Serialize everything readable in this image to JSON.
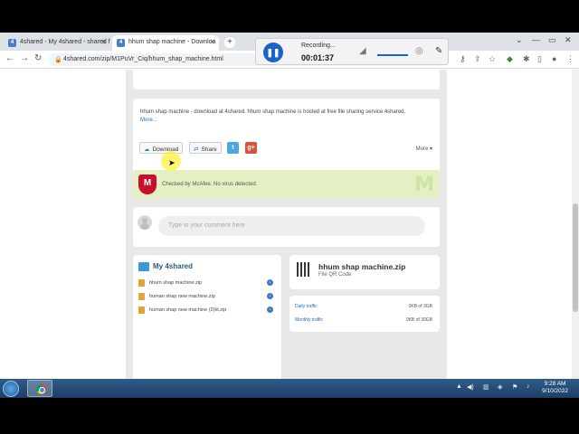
{
  "browser": {
    "tabs": [
      {
        "label": "4shared - My 4shared - shared f",
        "active": false
      },
      {
        "label": "hhum shap machine - Downloa",
        "active": true
      }
    ],
    "url": "4shared.com/zip/M1PuVr_Ciq/hhum_shap_machine.html"
  },
  "recorder": {
    "status": "Recording...",
    "timer": "00:01:37"
  },
  "file": {
    "description": "hhum shap machine - download at 4shared. hhum shap machine is hosted at free file sharing service 4shared.",
    "more_link": "More...",
    "buttons": {
      "download": "Download",
      "share": "Share",
      "twitter": "t",
      "gplus": "g+"
    },
    "more_dropdown": "More ▾",
    "scan_text": "Checked by McAfee. No virus detected.",
    "name": "hhum shap machine.zip",
    "qr_label": "File QR Code"
  },
  "comment": {
    "placeholder": "Type in your comment here"
  },
  "my4shared": {
    "title": "My 4shared",
    "files": [
      "hhum shap machine.zip",
      "human shap new machine.zip",
      "human shap new machine (2)kt.zip"
    ]
  },
  "traffic": [
    {
      "label": "Daily traffic",
      "value": "0KB of 3GB"
    },
    {
      "label": "Monthly traffic",
      "value": "0KB of 30GB"
    }
  ],
  "taskbar": {
    "time": "9:28 AM",
    "date": "9/10/2022"
  }
}
